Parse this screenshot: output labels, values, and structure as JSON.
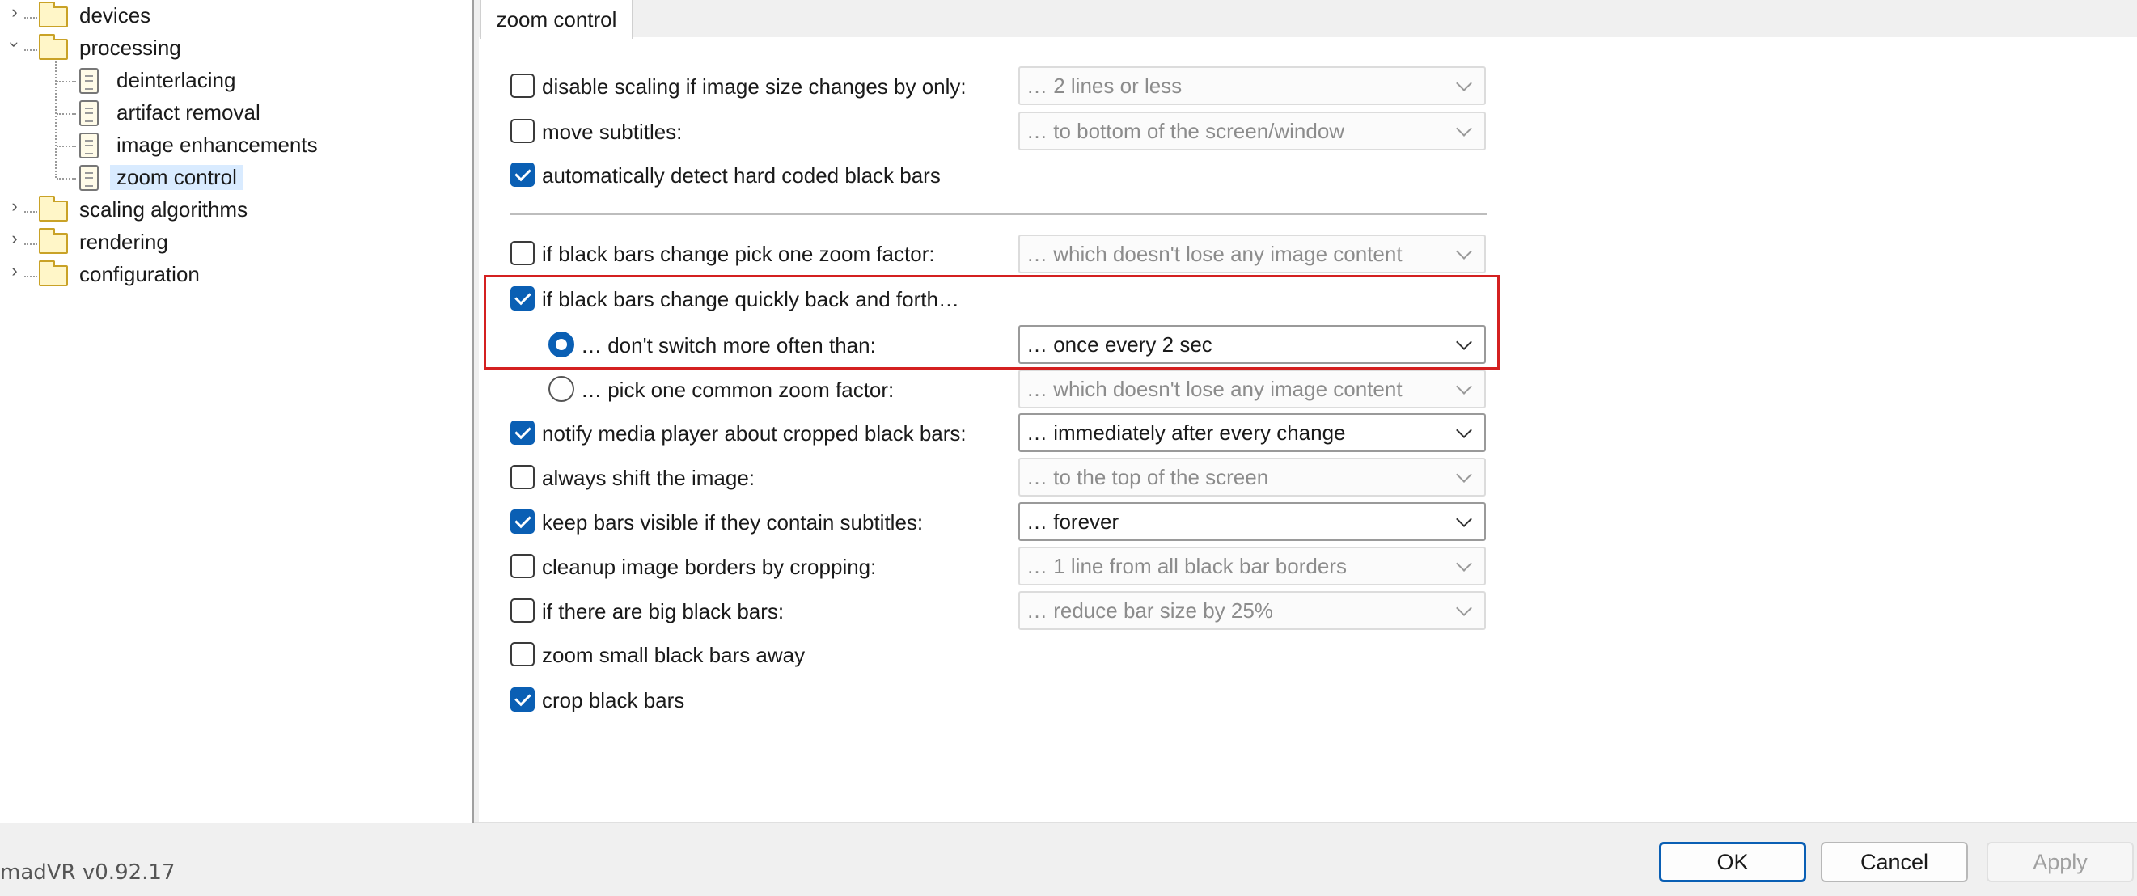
{
  "tree": {
    "items": [
      {
        "label": "devices",
        "expanded": false
      },
      {
        "label": "processing",
        "expanded": true,
        "children": [
          "deinterlacing",
          "artifact removal",
          "image enhancements",
          "zoom control"
        ]
      },
      {
        "label": "scaling algorithms",
        "expanded": false
      },
      {
        "label": "rendering",
        "expanded": false
      },
      {
        "label": "configuration",
        "expanded": false
      }
    ],
    "selected": "zoom control"
  },
  "tab": {
    "label": "zoom control"
  },
  "options": [
    {
      "label": "disable scaling if image size changes by only:",
      "checked": false,
      "dropdown": "… 2 lines or less",
      "enabled": false
    },
    {
      "label": "move subtitles:",
      "checked": false,
      "dropdown": "… to bottom of the screen/window",
      "enabled": false
    },
    {
      "label": "automatically detect hard coded black bars",
      "checked": true
    },
    {
      "label": "if black bars change pick one zoom factor:",
      "checked": false,
      "dropdown": "… which doesn't lose any image content",
      "enabled": false
    },
    {
      "label": "if black bars change quickly back and forth…",
      "checked": true
    },
    {
      "label": "… don't switch more often than:",
      "radio": true,
      "selected": true,
      "dropdown": "… once every 2 sec",
      "enabled": true
    },
    {
      "label": "… pick one common zoom factor:",
      "radio": true,
      "selected": false,
      "dropdown": "… which doesn't lose any image content",
      "enabled": false
    },
    {
      "label": "notify media player about cropped black bars:",
      "checked": true,
      "dropdown": "… immediately after every change",
      "enabled": true
    },
    {
      "label": "always shift the image:",
      "checked": false,
      "dropdown": "… to the top of the screen",
      "enabled": false
    },
    {
      "label": "keep bars visible if they contain subtitles:",
      "checked": true,
      "dropdown": "… forever",
      "enabled": true
    },
    {
      "label": "cleanup image borders by cropping:",
      "checked": false,
      "dropdown": "… 1 line from all black bar borders",
      "enabled": false
    },
    {
      "label": "if there are big black bars:",
      "checked": false,
      "dropdown": "… reduce bar size by 25%",
      "enabled": false
    },
    {
      "label": "zoom small black bars away",
      "checked": false
    },
    {
      "label": "crop black bars",
      "checked": true
    }
  ],
  "footer": {
    "version": "madVR v0.92.17",
    "ok_label": "OK",
    "cancel_label": "Cancel",
    "apply_label": "Apply"
  },
  "colors": {
    "accent": "#0a5fb4",
    "highlight_box": "#d42020",
    "selection": "#d9ebff"
  }
}
